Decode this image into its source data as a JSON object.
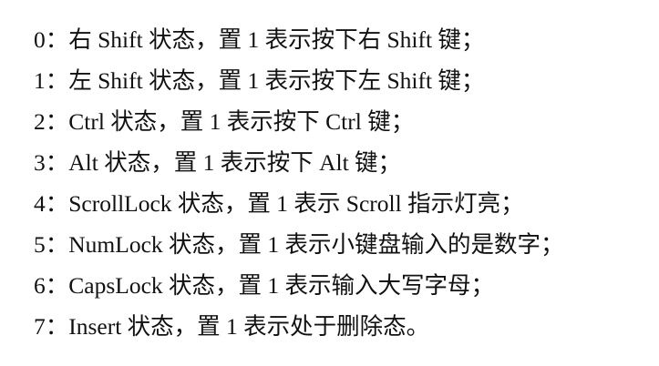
{
  "document": {
    "lines": [
      "0：右 Shift 状态，置 1 表示按下右 Shift 键；",
      "1：左 Shift 状态，置 1 表示按下左 Shift 键；",
      "2：Ctrl 状态，置 1 表示按下 Ctrl 键；",
      "3：Alt 状态，置 1 表示按下 Alt 键；",
      "4：ScrollLock 状态，置 1 表示 Scroll 指示灯亮；",
      "5：NumLock 状态，置 1 表示小键盘输入的是数字；",
      "6：CapsLock 状态，置 1 表示输入大写字母；",
      "7：Insert 状态，置 1 表示处于删除态。"
    ]
  }
}
